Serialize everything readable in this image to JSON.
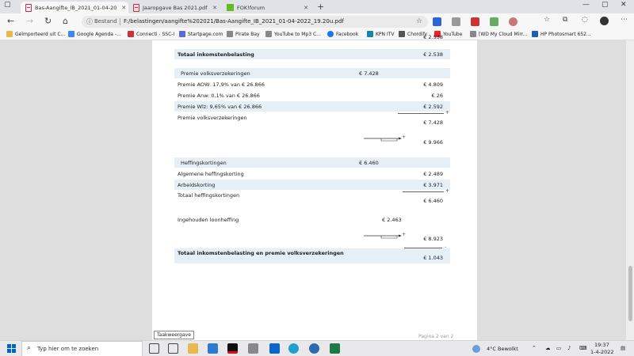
{
  "browser": {
    "tabs": [
      {
        "label": "Bas-Aangifte_IB_2021_01-04-20",
        "active": true
      },
      {
        "label": "Jaaropgave Bas 2021.pdf",
        "active": false
      },
      {
        "label": "FOK!forum",
        "active": false
      }
    ],
    "address": {
      "info_label": "Bestand",
      "url": "F:/belastingen/aangifte%202021/Bas-Aangifte_IB_2021_01-04-2022_19.20u.pdf"
    },
    "bookmarks": [
      {
        "label": "Geïmporteerd uit C...",
        "color": "#e8b84a"
      },
      {
        "label": "Google Agenda -...",
        "color": "#4285f4"
      },
      {
        "label": "Connecti - SSC-I",
        "color": "#c33"
      },
      {
        "label": "Startpage.com",
        "color": "#5b6bd6"
      },
      {
        "label": "Pirate Bay",
        "color": "#888"
      },
      {
        "label": "YouTube to Mp3 C...",
        "color": "#888"
      },
      {
        "label": "Facebook",
        "color": "#1877f2"
      },
      {
        "label": "KPN ITV",
        "color": "#18a"
      },
      {
        "label": "Chordify",
        "color": "#555"
      },
      {
        "label": "YouTube",
        "color": "#e22"
      },
      {
        "label": "[WD My Cloud Mirr...",
        "color": "#888"
      },
      {
        "label": "HP Photosmart 652...",
        "color": "#1a5fb4"
      }
    ]
  },
  "document": {
    "top_partial_value": "€ 2.538",
    "totaal_ib_label": "Totaal inkomstenbelasting",
    "totaal_ib_value": "€ 2.538",
    "pv_header_label": "Premie volksverzekeringen",
    "pv_header_value": "€ 7.428",
    "aow_label": "Premie AOW: 17,9% van  € 26.866",
    "aow_value": "€ 4.809",
    "anw_label": "Premie Anw: 0,1% van  € 26.866",
    "anw_value": "€ 26",
    "wlz_label": "Premie Wlz: 9,65% van  € 26.866",
    "wlz_value": "€ 2.592",
    "pv_total_label": "Premie volksverzekeringen",
    "pv_total_value": "€ 7.428",
    "subtotal1_value": "€ 9.966",
    "hk_header_label": "Heffingskortingen",
    "hk_header_value": "€ 6.460",
    "ahk_label": "Algemene heffingskorting",
    "ahk_value": "€ 2.489",
    "ak_label": "Arbeidskorting",
    "ak_value": "€ 3.971",
    "hk_total_label": "Totaal heffingskortingen",
    "hk_total_value": "€ 6.460",
    "lh_label": "Ingehouden loonheffing",
    "lh_value": "€ 2.463",
    "subtotal2_value": "€ 8.923",
    "grand_label": "Totaal inkomstenbelasting en premie volksverzekeringen",
    "grand_value": "€ 1.043",
    "plus_sign": "+",
    "minus_sign": "-",
    "page_label": "Pagina 2 van 2"
  },
  "tooltip": "Taakweergave",
  "taskbar": {
    "search_placeholder": "Typ hier om te zoeken",
    "weather": "4°C  Bewolkt",
    "time": "19:37",
    "date": "1-4-2022"
  }
}
